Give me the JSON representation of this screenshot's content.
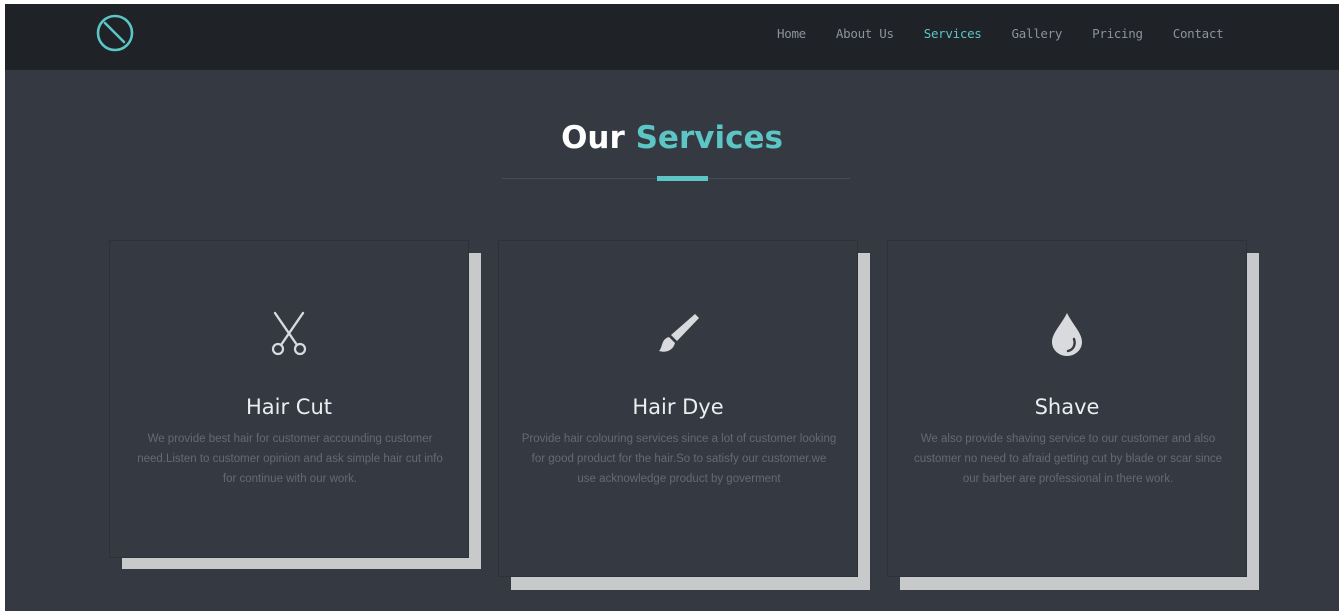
{
  "nav": {
    "logo": "circle-slash-logo",
    "items": [
      {
        "label": "Home",
        "active": false
      },
      {
        "label": "About Us",
        "active": false
      },
      {
        "label": "Services",
        "active": true
      },
      {
        "label": "Gallery",
        "active": false
      },
      {
        "label": "Pricing",
        "active": false
      },
      {
        "label": "Contact",
        "active": false
      }
    ]
  },
  "section": {
    "title_main": "Our",
    "title_accent": "Services"
  },
  "services": [
    {
      "icon": "scissors-icon",
      "title": "Hair Cut",
      "text": "We provide best hair for customer accounding customer need.Listen to customer opinion and ask simple hair cut info for continue with our work."
    },
    {
      "icon": "paintbrush-icon",
      "title": "Hair Dye",
      "text": "Provide hair colouring services since a lot of customer looking for good product for the hair.So to satisfy our customer.we use acknowledge product by goverment"
    },
    {
      "icon": "droplet-icon",
      "title": "Shave",
      "text": "We also provide shaving service to our customer and also customer no need to afraid getting cut by blade or scar since our barber are professional in there work."
    }
  ],
  "colors": {
    "accent": "#5cc5c5",
    "background": "#353a42",
    "navbar": "#1f2227"
  }
}
